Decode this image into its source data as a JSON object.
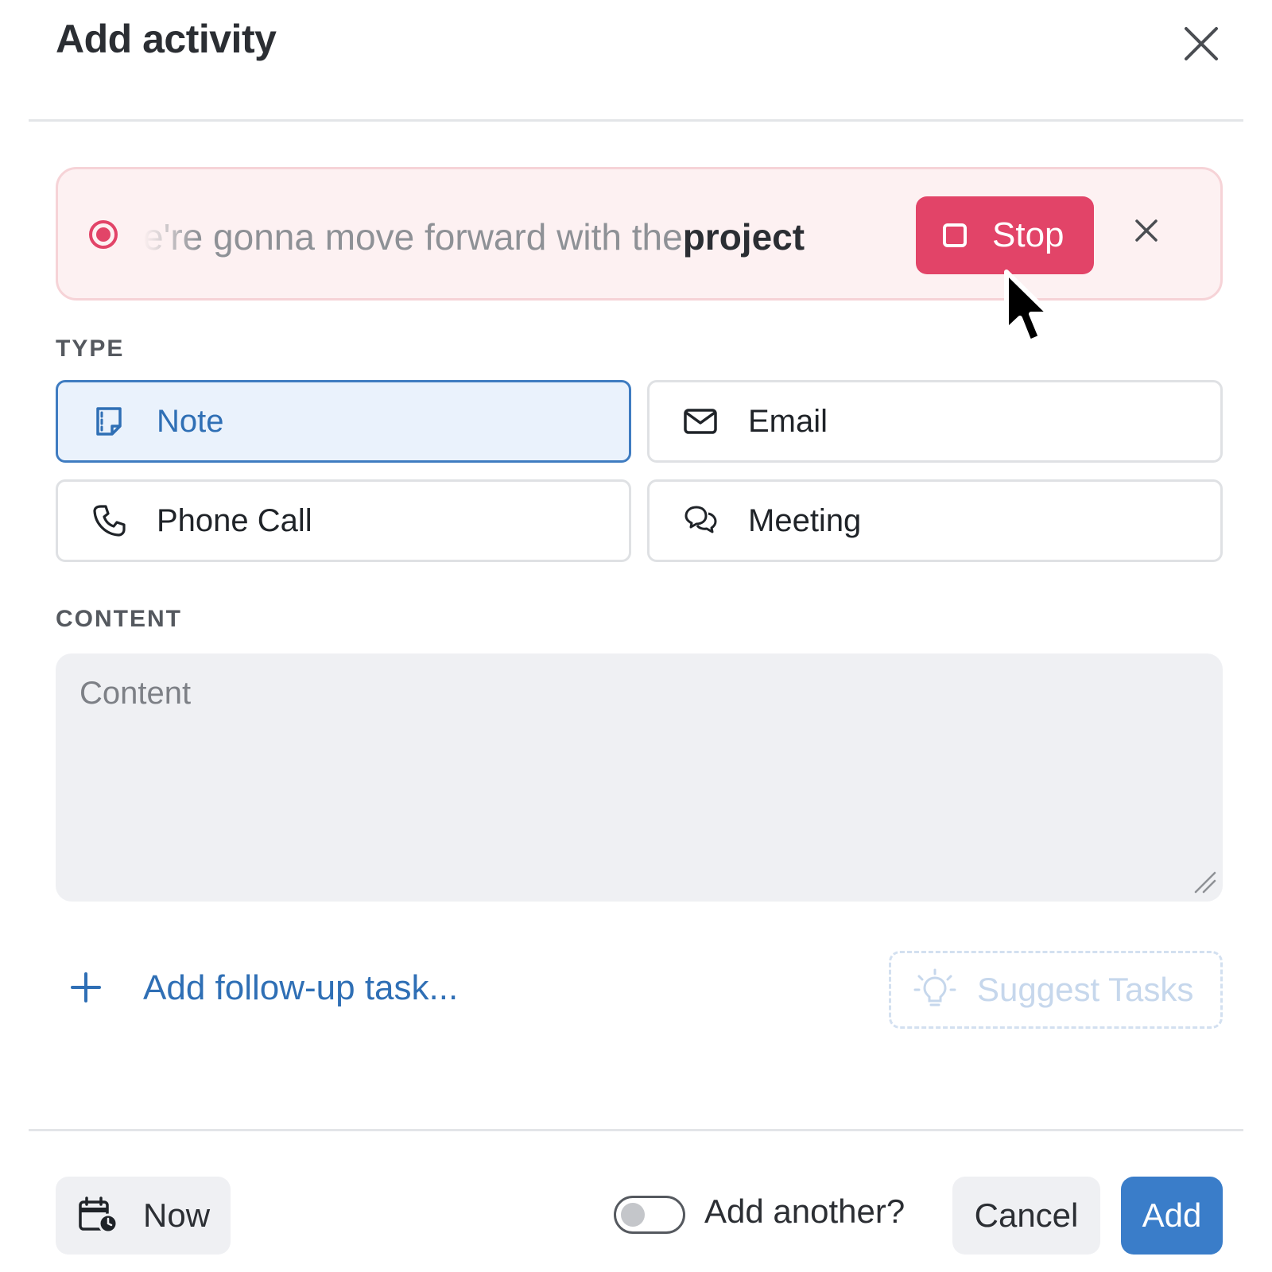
{
  "dialog": {
    "title": "Add activity"
  },
  "recording": {
    "transcript_prefix": "e're gonna move forward with the ",
    "transcript_emphasis": "project",
    "stop_label": "Stop"
  },
  "type_section": {
    "label": "TYPE",
    "options": [
      {
        "label": "Note",
        "icon": "note-icon",
        "selected": true
      },
      {
        "label": "Email",
        "icon": "envelope-icon",
        "selected": false
      },
      {
        "label": "Phone Call",
        "icon": "phone-icon",
        "selected": false
      },
      {
        "label": "Meeting",
        "icon": "chat-bubbles-icon",
        "selected": false
      }
    ]
  },
  "content_section": {
    "label": "CONTENT",
    "placeholder": "Content",
    "value": ""
  },
  "followup": {
    "label": "Add follow-up task...",
    "suggest_label": "Suggest Tasks"
  },
  "footer": {
    "now_label": "Now",
    "add_another_label": "Add another?",
    "add_another_on": false,
    "cancel_label": "Cancel",
    "add_label": "Add"
  },
  "colors": {
    "accent_blue": "#3a7dc9",
    "record_red": "#e24468",
    "banner_bg": "#fdf1f2"
  }
}
